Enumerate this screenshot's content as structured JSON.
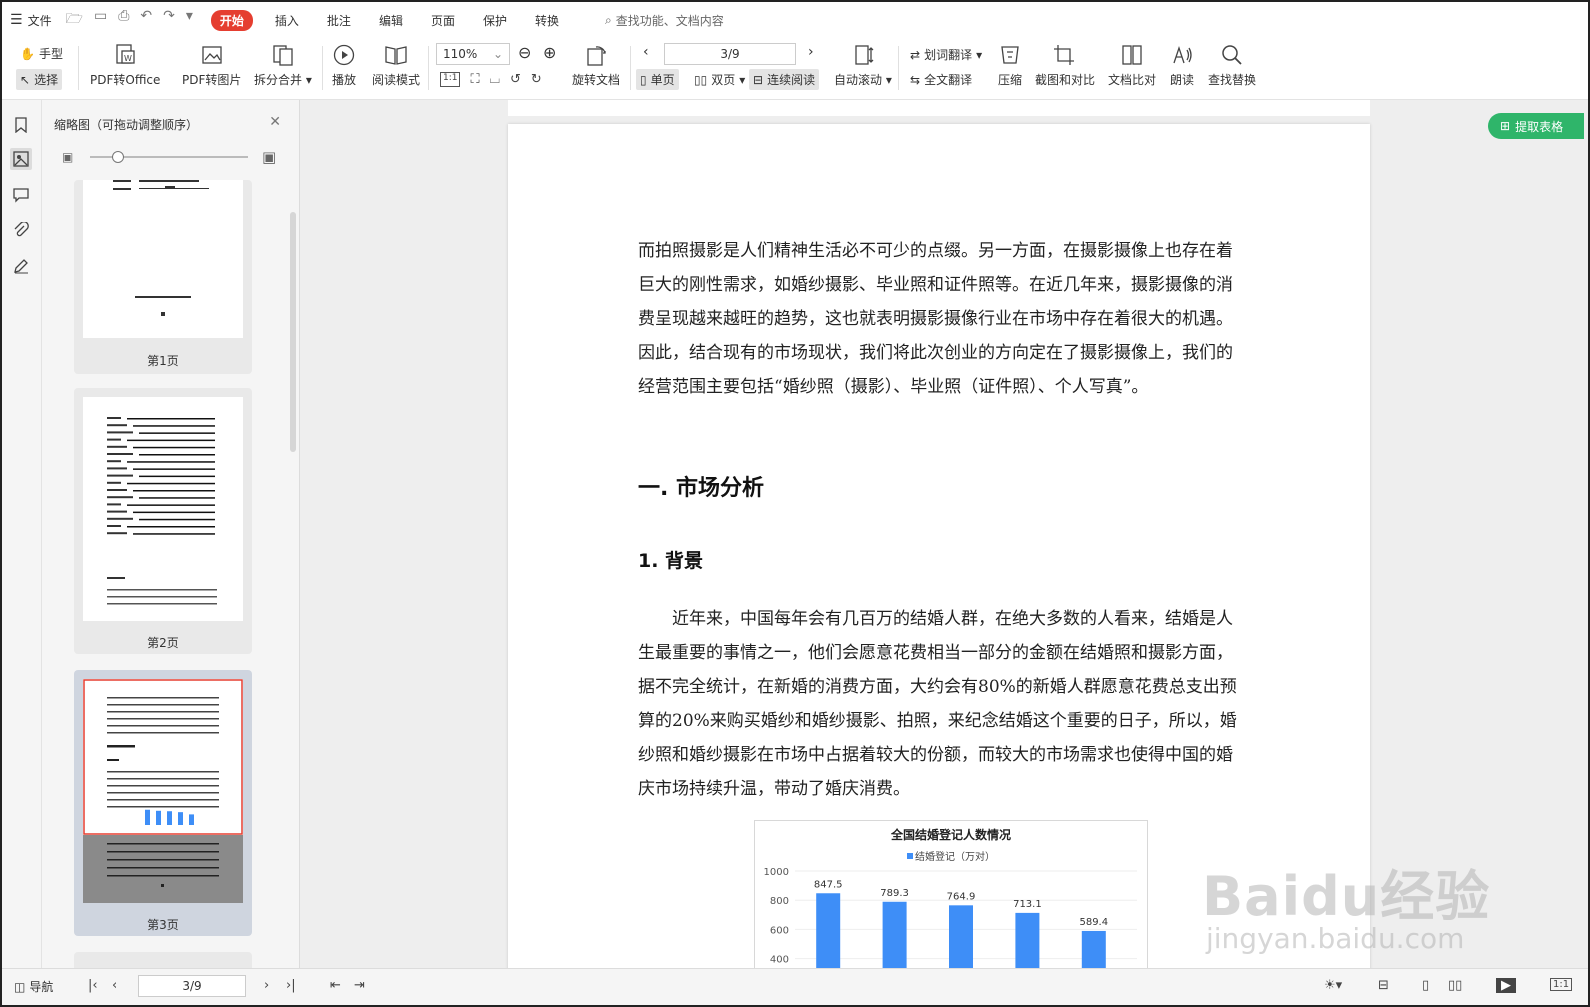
{
  "menubar": {
    "file": "文件",
    "tabs": [
      "开始",
      "插入",
      "批注",
      "编辑",
      "页面",
      "保护",
      "转换"
    ],
    "search_placeholder": "查找功能、文档内容"
  },
  "ribbon": {
    "hand": "手型",
    "select": "选择",
    "pdf_to_office": "PDF转Office",
    "pdf_to_image": "PDF转图片",
    "split_merge": "拆分合并",
    "play": "播放",
    "read_mode": "阅读模式",
    "zoom": "110%",
    "rotate": "旋转文档",
    "page_indicator": "3/9",
    "single": "单页",
    "double": "双页",
    "continuous": "连续阅读",
    "auto_scroll": "自动滚动",
    "word_translate": "划词翻译",
    "full_translate": "全文翻译",
    "compress": "压缩",
    "screenshot_compare": "截图和对比",
    "doc_compare": "文档比对",
    "read_aloud": "朗读",
    "find_replace": "查找替换",
    "ratio": "1:1"
  },
  "thumbs": {
    "title": "缩略图（可拖动调整顺序）",
    "pages": [
      "第1页",
      "第2页",
      "第3页"
    ]
  },
  "extract_table": "提取表格",
  "doc": {
    "para1": "而拍照摄影是人们精神生活必不可少的点缀。另一方面，在摄影摄像上也存在着巨大的刚性需求，如婚纱摄影、毕业照和证件照等。在近几年来，摄影摄像的消费呈现越来越旺的趋势，这也就表明摄影摄像行业在市场中存在着很大的机遇。因此，结合现有的市场现状，我们将此次创业的方向定在了摄影摄像上，我们的经营范围主要包括“婚纱照（摄影）、毕业照（证件照）、个人写真”。",
    "heading1": "一. 市场分析",
    "heading2": "1. 背景",
    "para2": "近年来，中国每年会有几百万的结婚人群，在绝大多数的人看来，结婚是人生最重要的事情之一，他们会愿意花费相当一部分的金额在结婚照和摄影方面，据不完全统计，在新婚的消费方面，大约会有80%的新婚人群愿意花费总支出预算的20%来购买婚纱和婚纱摄影、拍照，来纪念结婚这个重要的日子，所以，婚纱照和婚纱摄影在市场中占据着较大的份额，而较大的市场需求也使得中国的婚庆市场持续升温，带动了婚庆消费。"
  },
  "status": {
    "nav": "导航",
    "page": "3/9"
  },
  "watermark": {
    "logo": "Baidu经验",
    "url": "jingyan.baidu.com"
  },
  "chart_data": {
    "type": "bar",
    "title": "全国结婚登记人数情况",
    "series": [
      {
        "name": "结婚登记（万对）",
        "values": [
          847.5,
          789.3,
          764.9,
          713.1,
          589.4
        ]
      }
    ],
    "categories": [
      "",
      "",
      "",
      "",
      ""
    ],
    "yticks": [
      "1000",
      "800",
      "600",
      "400"
    ],
    "ylim": [
      0,
      1000
    ],
    "color": "#3e8ef7"
  }
}
